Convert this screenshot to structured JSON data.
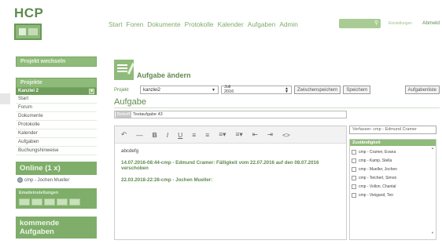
{
  "app": {
    "logo_text": "HCP"
  },
  "nav": {
    "items": [
      "Start",
      "Foren",
      "Dokumente",
      "Protokolle",
      "Kalender",
      "Aufgaben",
      "Admin"
    ]
  },
  "header": {
    "einstellungen": "Einstellungen",
    "abmelden": "Abmeld"
  },
  "sidebar": {
    "projekt_wechseln": "Projekt wechseln",
    "projekte_title": "Projekte",
    "selected_project": "Kanzlei 2",
    "items": [
      "Start",
      "Forum",
      "Dokumente",
      "Protokolle",
      "Kalender",
      "Aufgaben",
      "Buchungshinweise"
    ],
    "online_title": "Online (1 x)",
    "online_user": "cmp - Jochen Mueller",
    "email_title": "Emaileinstellungen",
    "kommende_title": "kommende Aufgaben"
  },
  "main": {
    "page_title": "Aufgabe ändern",
    "projekt_label": "Projekt",
    "projekt_value": "kanzlei2",
    "date_line1": "Juli",
    "date_line2": "2016",
    "btn_zwischenspeichern": "Zwischenspeichern",
    "btn_speichern": "Speichern",
    "btn_aufgabenliste": "Aufgabenliste",
    "aufgabe_label": "Aufgabe",
    "title_prefix": "Betreff",
    "title_value": "Testaufgabe 43",
    "editor": {
      "line1": "abcdefg",
      "entry1": "14.07.2016-08:44-cmp - Edmund Cramer: Fälligkeit vom 22.07.2016 auf den 08.07.2016 verschoben",
      "entry2": "22.03.2018-22:28-cmp - Jochen Mueller:"
    },
    "verfasser": "Verfasser: cmp - Edmund Cramer",
    "zustaendigkeit_title": "Zuständigkeit",
    "zustaendig": [
      "cmp - Cramer, Evana",
      "cmp - Kamp, Stella",
      "cmp - Mueller, Jochen",
      "cmp - Teichert, Simon",
      "cmp - Vollon, Chantal",
      "cmp - Vieigand, Ten"
    ]
  }
}
